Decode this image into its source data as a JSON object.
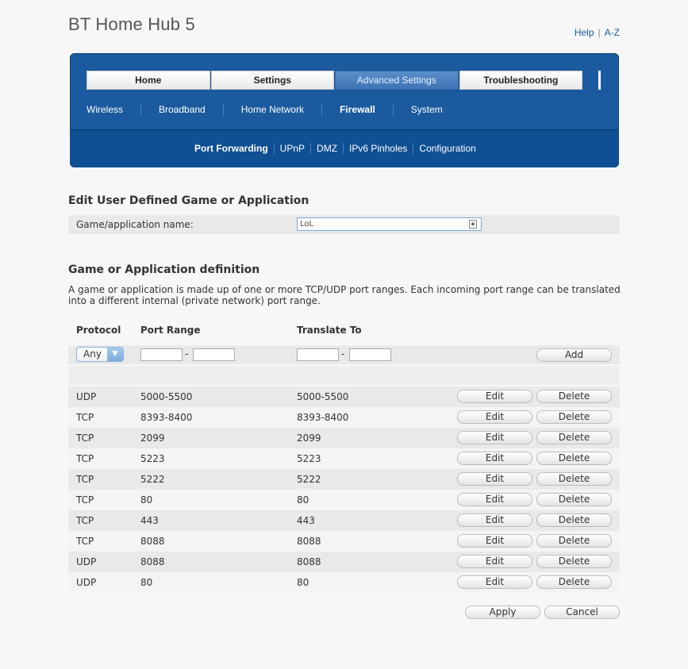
{
  "header": {
    "brand": "BT Home Hub 5",
    "help_label": "Help",
    "separator": "|",
    "az_label": "A-Z"
  },
  "nav": {
    "tabs": [
      {
        "label": "Home",
        "active": false
      },
      {
        "label": "Settings",
        "active": false
      },
      {
        "label": "Advanced Settings",
        "active": true
      },
      {
        "label": "Troubleshooting",
        "active": false
      }
    ],
    "subnav": [
      "Wireless",
      "Broadband",
      "Home Network",
      "Firewall",
      "System"
    ],
    "subnav_active": "Firewall",
    "subsub": [
      "Port Forwarding",
      "UPnP",
      "DMZ",
      "IPv6 Pinholes",
      "Configuration"
    ],
    "subsub_active": "Port Forwarding"
  },
  "edit_section": {
    "title": "Edit User Defined Game or Application",
    "name_label": "Game/application name:",
    "name_value": "LoL"
  },
  "definition": {
    "title": "Game or Application definition",
    "description": "A game or application is made up of one or more TCP/UDP port ranges. Each incoming port range can be translated into a different internal (private network) port range.",
    "headers": {
      "protocol": "Protocol",
      "port_range": "Port Range",
      "translate_to": "Translate To"
    },
    "new_rule": {
      "protocol": "Any",
      "dash": "-",
      "add_label": "Add"
    },
    "rows": [
      {
        "protocol": "UDP",
        "port_range": "5000-5500",
        "translate_to": "5000-5500"
      },
      {
        "protocol": "TCP",
        "port_range": "8393-8400",
        "translate_to": "8393-8400"
      },
      {
        "protocol": "TCP",
        "port_range": "2099",
        "translate_to": "2099"
      },
      {
        "protocol": "TCP",
        "port_range": "5223",
        "translate_to": "5223"
      },
      {
        "protocol": "TCP",
        "port_range": "5222",
        "translate_to": "5222"
      },
      {
        "protocol": "TCP",
        "port_range": "80",
        "translate_to": "80"
      },
      {
        "protocol": "TCP",
        "port_range": "443",
        "translate_to": "443"
      },
      {
        "protocol": "TCP",
        "port_range": "8088",
        "translate_to": "8088"
      },
      {
        "protocol": "UDP",
        "port_range": "8088",
        "translate_to": "8088"
      },
      {
        "protocol": "UDP",
        "port_range": "80",
        "translate_to": "80"
      }
    ],
    "edit_label": "Edit",
    "delete_label": "Delete"
  },
  "footer": {
    "apply_label": "Apply",
    "cancel_label": "Cancel"
  },
  "colors": {
    "nav_blue": "#1b5a9e",
    "nav_dark": "#0f4f93",
    "active_tab": "#4f84c2",
    "link": "#1a5a9a"
  }
}
